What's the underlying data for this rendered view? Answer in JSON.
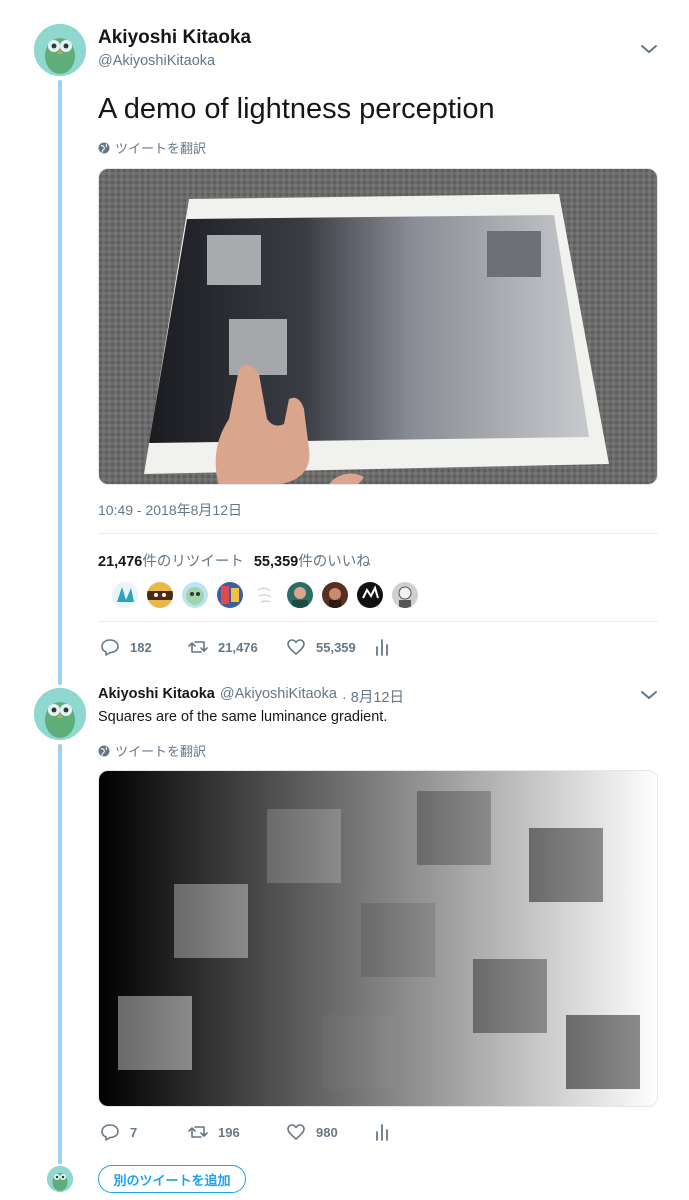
{
  "tweet1": {
    "author_name": "Akiyoshi Kitaoka",
    "author_handle": "@AkiyoshiKitaoka",
    "text": "A demo of lightness perception",
    "translate_label": "ツイートを翻訳",
    "timestamp": "10:49 - 2018年8月12日",
    "retweet_count": "21,476",
    "retweet_label": "件のリツイート",
    "like_count": "55,359",
    "like_label": "件のいいね",
    "actions": {
      "reply": "182",
      "retweet": "21,476",
      "like": "55,359"
    }
  },
  "tweet2": {
    "author_name": "Akiyoshi Kitaoka",
    "author_handle": "@AkiyoshiKitaoka",
    "date": "· 8月12日",
    "text": "Squares are of the same luminance gradient.",
    "translate_label": "ツイートを翻訳",
    "actions": {
      "reply": "7",
      "retweet": "196",
      "like": "980"
    }
  },
  "add_tweet_label": "別のツイートを追加",
  "colors": {
    "accent": "#1da1f2",
    "thread_line": "#9fd1f0",
    "muted": "#657786",
    "text": "#14171a"
  },
  "icons": [
    "chevron-down-icon",
    "globe-icon",
    "reply-icon",
    "retweet-icon",
    "heart-icon",
    "analytics-icon"
  ]
}
